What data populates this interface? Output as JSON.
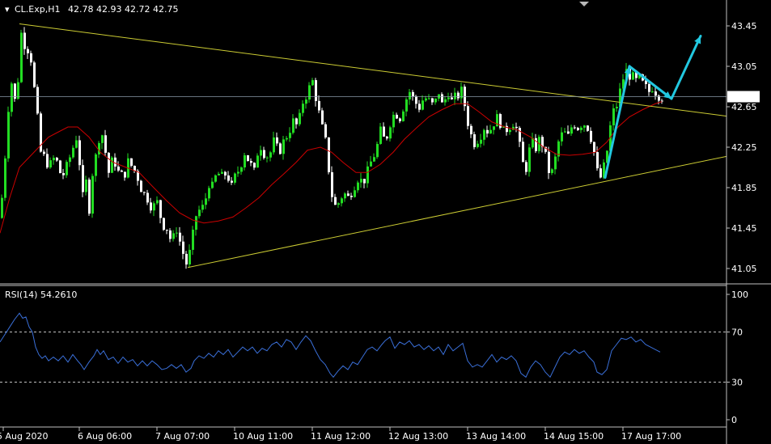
{
  "header": {
    "symbol": "CL.Exp,H1",
    "ohlc": "42.78 42.93 42.72 42.75"
  },
  "indicator": {
    "label": "RSI(14) 54.2610"
  },
  "colors": {
    "background": "#000000",
    "bull": "#22dd22",
    "bear": "#ffffff",
    "ma": "#cc0000",
    "trendline": "#cccc33",
    "arrow": "#22c8e0",
    "rsi": "#3a6fd8",
    "grid": "#c0c0c0"
  },
  "chart_data": [
    {
      "type": "candlestick",
      "symbol": "CL.Exp",
      "timeframe": "H1",
      "ylim": [
        40.86,
        43.6
      ],
      "y_ticks": [
        "43.45",
        "43.05",
        "42.65",
        "42.25",
        "41.85",
        "41.45",
        "41.05"
      ],
      "y_tick_values": [
        43.45,
        43.05,
        42.65,
        42.25,
        41.85,
        41.45,
        41.05
      ],
      "current_price": 42.75,
      "current_price_label": "42.75",
      "x_ticks": [
        "5 Aug 2020",
        "6 Aug 06:00",
        "7 Aug 07:00",
        "10 Aug 11:00",
        "11 Aug 12:00",
        "12 Aug 13:00",
        "13 Aug 14:00",
        "14 Aug 15:00",
        "17 Aug 17:00"
      ],
      "close_path": [
        [
          0,
          41.55
        ],
        [
          5,
          42.05
        ],
        [
          10,
          42.65
        ],
        [
          15,
          42.95
        ],
        [
          20,
          42.55
        ],
        [
          24,
          43.3
        ],
        [
          28,
          43.45
        ],
        [
          32,
          43.1
        ],
        [
          36,
          43.35
        ],
        [
          40,
          42.9
        ],
        [
          44,
          42.75
        ],
        [
          48,
          42.3
        ],
        [
          52,
          42.1
        ],
        [
          56,
          42.2
        ],
        [
          60,
          42.0
        ],
        [
          64,
          42.15
        ],
        [
          70,
          42.1
        ],
        [
          76,
          41.95
        ],
        [
          82,
          42.05
        ],
        [
          88,
          42.2
        ],
        [
          94,
          42.35
        ],
        [
          98,
          42.1
        ],
        [
          102,
          41.75
        ],
        [
          106,
          41.9
        ],
        [
          110,
          41.65
        ],
        [
          114,
          42.0
        ],
        [
          118,
          42.15
        ],
        [
          124,
          42.45
        ],
        [
          128,
          42.3
        ],
        [
          134,
          42.0
        ],
        [
          140,
          42.15
        ],
        [
          146,
          42.0
        ],
        [
          152,
          41.95
        ],
        [
          158,
          42.1
        ],
        [
          164,
          42.05
        ],
        [
          170,
          41.95
        ],
        [
          176,
          41.8
        ],
        [
          182,
          41.75
        ],
        [
          188,
          41.65
        ],
        [
          194,
          41.7
        ],
        [
          200,
          41.5
        ],
        [
          206,
          41.45
        ],
        [
          212,
          41.3
        ],
        [
          218,
          41.45
        ],
        [
          224,
          41.25
        ],
        [
          230,
          41.1
        ],
        [
          236,
          41.25
        ],
        [
          240,
          41.5
        ],
        [
          244,
          41.65
        ],
        [
          248,
          41.6
        ],
        [
          254,
          41.75
        ],
        [
          258,
          41.9
        ],
        [
          262,
          41.85
        ],
        [
          268,
          42.0
        ],
        [
          274,
          41.95
        ],
        [
          280,
          42.0
        ],
        [
          286,
          41.85
        ],
        [
          290,
          41.95
        ],
        [
          296,
          42.05
        ],
        [
          302,
          42.2
        ],
        [
          308,
          42.1
        ],
        [
          314,
          42.0
        ],
        [
          320,
          42.3
        ],
        [
          326,
          42.2
        ],
        [
          332,
          42.15
        ],
        [
          338,
          42.3
        ],
        [
          344,
          42.2
        ],
        [
          350,
          42.3
        ],
        [
          356,
          42.4
        ],
        [
          362,
          42.5
        ],
        [
          368,
          42.45
        ],
        [
          374,
          42.7
        ],
        [
          380,
          42.8
        ],
        [
          386,
          42.9
        ],
        [
          390,
          42.75
        ],
        [
          396,
          42.5
        ],
        [
          402,
          42.3
        ],
        [
          408,
          41.9
        ],
        [
          412,
          41.65
        ],
        [
          418,
          41.7
        ],
        [
          424,
          41.8
        ],
        [
          430,
          41.75
        ],
        [
          436,
          41.85
        ],
        [
          442,
          41.95
        ],
        [
          448,
          41.9
        ],
        [
          454,
          42.0
        ],
        [
          460,
          42.15
        ],
        [
          464,
          42.2
        ],
        [
          470,
          42.4
        ],
        [
          476,
          42.3
        ],
        [
          482,
          42.5
        ],
        [
          488,
          42.6
        ],
        [
          494,
          42.55
        ],
        [
          500,
          42.7
        ],
        [
          506,
          42.8
        ],
        [
          512,
          42.7
        ],
        [
          518,
          42.65
        ],
        [
          524,
          42.75
        ],
        [
          530,
          42.7
        ],
        [
          536,
          42.65
        ],
        [
          542,
          42.8
        ],
        [
          548,
          42.6
        ],
        [
          552,
          42.85
        ],
        [
          558,
          42.7
        ],
        [
          564,
          42.75
        ],
        [
          570,
          42.8
        ],
        [
          576,
          42.6
        ],
        [
          580,
          42.4
        ],
        [
          586,
          42.3
        ],
        [
          592,
          42.35
        ],
        [
          598,
          42.45
        ],
        [
          604,
          42.4
        ],
        [
          610,
          42.5
        ],
        [
          616,
          42.55
        ],
        [
          622,
          42.4
        ],
        [
          628,
          42.45
        ],
        [
          634,
          42.5
        ],
        [
          640,
          42.4
        ],
        [
          644,
          42.1
        ],
        [
          650,
          42.05
        ],
        [
          656,
          42.3
        ],
        [
          662,
          42.25
        ],
        [
          668,
          42.35
        ],
        [
          674,
          42.15
        ],
        [
          680,
          41.95
        ],
        [
          684,
          42.05
        ],
        [
          690,
          42.3
        ],
        [
          696,
          42.4
        ],
        [
          702,
          42.35
        ],
        [
          708,
          42.5
        ],
        [
          714,
          42.45
        ],
        [
          720,
          42.5
        ],
        [
          726,
          42.45
        ],
        [
          732,
          42.3
        ],
        [
          738,
          42.0
        ],
        [
          742,
          41.95
        ],
        [
          748,
          42.1
        ],
        [
          754,
          42.45
        ],
        [
          758,
          42.6
        ],
        [
          764,
          42.7
        ],
        [
          768,
          42.9
        ],
        [
          774,
          43.0
        ],
        [
          780,
          42.95
        ],
        [
          786,
          42.9
        ],
        [
          790,
          42.92
        ],
        [
          796,
          42.85
        ],
        [
          802,
          42.8
        ],
        [
          806,
          42.85
        ],
        [
          812,
          42.78
        ],
        [
          818,
          42.75
        ]
      ],
      "bars_from": 0,
      "bars_to": 818,
      "moving_average": [
        [
          0,
          41.4
        ],
        [
          12,
          41.75
        ],
        [
          24,
          42.05
        ],
        [
          36,
          42.15
        ],
        [
          48,
          42.25
        ],
        [
          60,
          42.35
        ],
        [
          72,
          42.4
        ],
        [
          84,
          42.45
        ],
        [
          96,
          42.45
        ],
        [
          110,
          42.35
        ],
        [
          124,
          42.2
        ],
        [
          140,
          42.1
        ],
        [
          156,
          42.05
        ],
        [
          172,
          42.0
        ],
        [
          190,
          41.85
        ],
        [
          206,
          41.72
        ],
        [
          222,
          41.6
        ],
        [
          238,
          41.53
        ],
        [
          252,
          41.5
        ],
        [
          270,
          41.52
        ],
        [
          288,
          41.56
        ],
        [
          304,
          41.65
        ],
        [
          320,
          41.75
        ],
        [
          336,
          41.88
        ],
        [
          350,
          41.98
        ],
        [
          366,
          42.1
        ],
        [
          380,
          42.22
        ],
        [
          396,
          42.25
        ],
        [
          410,
          42.2
        ],
        [
          424,
          42.1
        ],
        [
          440,
          42.0
        ],
        [
          454,
          42.0
        ],
        [
          470,
          42.08
        ],
        [
          486,
          42.2
        ],
        [
          500,
          42.33
        ],
        [
          516,
          42.45
        ],
        [
          530,
          42.55
        ],
        [
          546,
          42.62
        ],
        [
          562,
          42.68
        ],
        [
          578,
          42.68
        ],
        [
          592,
          42.6
        ],
        [
          608,
          42.5
        ],
        [
          624,
          42.45
        ],
        [
          640,
          42.42
        ],
        [
          656,
          42.35
        ],
        [
          672,
          42.25
        ],
        [
          688,
          42.18
        ],
        [
          704,
          42.17
        ],
        [
          720,
          42.18
        ],
        [
          736,
          42.2
        ],
        [
          750,
          42.3
        ],
        [
          764,
          42.45
        ],
        [
          778,
          42.55
        ],
        [
          794,
          42.62
        ],
        [
          810,
          42.68
        ],
        [
          818,
          42.7
        ]
      ],
      "trendlines": [
        {
          "from": [
            24,
            43.47
          ],
          "to": [
            953,
            42.5
          ]
        },
        {
          "from": [
            232,
            41.06
          ],
          "to": [
            953,
            42.25
          ]
        }
      ],
      "arrows": [
        {
          "from": [
            748,
            41.95
          ],
          "to": [
            778,
            43.05
          ]
        },
        {
          "from": [
            778,
            43.05
          ],
          "to": [
            830,
            42.73
          ]
        },
        {
          "from": [
            830,
            42.73
          ],
          "to": [
            866,
            43.35
          ]
        }
      ]
    },
    {
      "type": "line",
      "name": "RSI(14)",
      "last_value": 54.261,
      "ylim": [
        0,
        100
      ],
      "y_ticks": [
        "100",
        "70",
        "30",
        "0"
      ],
      "y_tick_values": [
        100,
        70,
        30,
        0
      ],
      "levels": [
        70,
        30
      ],
      "values": [
        [
          0,
          62
        ],
        [
          6,
          68
        ],
        [
          12,
          74
        ],
        [
          18,
          80
        ],
        [
          24,
          85
        ],
        [
          28,
          81
        ],
        [
          32,
          82
        ],
        [
          36,
          74
        ],
        [
          40,
          70
        ],
        [
          44,
          58
        ],
        [
          48,
          52
        ],
        [
          52,
          49
        ],
        [
          56,
          51
        ],
        [
          60,
          47
        ],
        [
          66,
          50
        ],
        [
          72,
          47
        ],
        [
          78,
          51
        ],
        [
          84,
          46
        ],
        [
          90,
          52
        ],
        [
          96,
          47
        ],
        [
          100,
          44
        ],
        [
          104,
          40
        ],
        [
          110,
          46
        ],
        [
          116,
          51
        ],
        [
          120,
          56
        ],
        [
          124,
          52
        ],
        [
          128,
          55
        ],
        [
          134,
          48
        ],
        [
          140,
          50
        ],
        [
          146,
          45
        ],
        [
          152,
          50
        ],
        [
          158,
          46
        ],
        [
          164,
          48
        ],
        [
          170,
          43
        ],
        [
          176,
          47
        ],
        [
          182,
          43
        ],
        [
          188,
          47
        ],
        [
          194,
          44
        ],
        [
          200,
          40
        ],
        [
          206,
          41
        ],
        [
          212,
          44
        ],
        [
          218,
          41
        ],
        [
          224,
          44
        ],
        [
          230,
          38
        ],
        [
          236,
          41
        ],
        [
          240,
          47
        ],
        [
          246,
          51
        ],
        [
          252,
          49
        ],
        [
          258,
          53
        ],
        [
          264,
          50
        ],
        [
          270,
          55
        ],
        [
          276,
          52
        ],
        [
          282,
          56
        ],
        [
          288,
          50
        ],
        [
          294,
          54
        ],
        [
          300,
          58
        ],
        [
          306,
          55
        ],
        [
          312,
          58
        ],
        [
          318,
          53
        ],
        [
          324,
          57
        ],
        [
          330,
          55
        ],
        [
          336,
          60
        ],
        [
          342,
          62
        ],
        [
          348,
          58
        ],
        [
          354,
          64
        ],
        [
          360,
          62
        ],
        [
          366,
          56
        ],
        [
          372,
          62
        ],
        [
          378,
          67
        ],
        [
          384,
          63
        ],
        [
          390,
          55
        ],
        [
          396,
          48
        ],
        [
          402,
          44
        ],
        [
          408,
          37
        ],
        [
          412,
          34
        ],
        [
          418,
          39
        ],
        [
          424,
          43
        ],
        [
          430,
          40
        ],
        [
          436,
          46
        ],
        [
          442,
          44
        ],
        [
          448,
          50
        ],
        [
          454,
          56
        ],
        [
          460,
          58
        ],
        [
          466,
          55
        ],
        [
          472,
          60
        ],
        [
          476,
          63
        ],
        [
          482,
          66
        ],
        [
          488,
          57
        ],
        [
          494,
          62
        ],
        [
          500,
          60
        ],
        [
          506,
          63
        ],
        [
          512,
          58
        ],
        [
          518,
          60
        ],
        [
          524,
          56
        ],
        [
          530,
          59
        ],
        [
          536,
          55
        ],
        [
          542,
          58
        ],
        [
          548,
          52
        ],
        [
          554,
          60
        ],
        [
          560,
          55
        ],
        [
          566,
          58
        ],
        [
          572,
          61
        ],
        [
          578,
          47
        ],
        [
          584,
          42
        ],
        [
          590,
          44
        ],
        [
          596,
          42
        ],
        [
          602,
          47
        ],
        [
          608,
          52
        ],
        [
          614,
          46
        ],
        [
          620,
          50
        ],
        [
          626,
          48
        ],
        [
          632,
          51
        ],
        [
          638,
          47
        ],
        [
          644,
          37
        ],
        [
          650,
          34
        ],
        [
          656,
          42
        ],
        [
          662,
          47
        ],
        [
          668,
          44
        ],
        [
          674,
          38
        ],
        [
          680,
          34
        ],
        [
          686,
          42
        ],
        [
          692,
          50
        ],
        [
          698,
          54
        ],
        [
          704,
          52
        ],
        [
          710,
          56
        ],
        [
          716,
          53
        ],
        [
          722,
          55
        ],
        [
          728,
          50
        ],
        [
          734,
          46
        ],
        [
          738,
          38
        ],
        [
          744,
          36
        ],
        [
          750,
          40
        ],
        [
          756,
          55
        ],
        [
          762,
          60
        ],
        [
          768,
          65
        ],
        [
          774,
          64
        ],
        [
          780,
          66
        ],
        [
          786,
          62
        ],
        [
          792,
          64
        ],
        [
          798,
          60
        ],
        [
          804,
          58
        ],
        [
          810,
          56
        ],
        [
          816,
          54
        ]
      ]
    }
  ]
}
